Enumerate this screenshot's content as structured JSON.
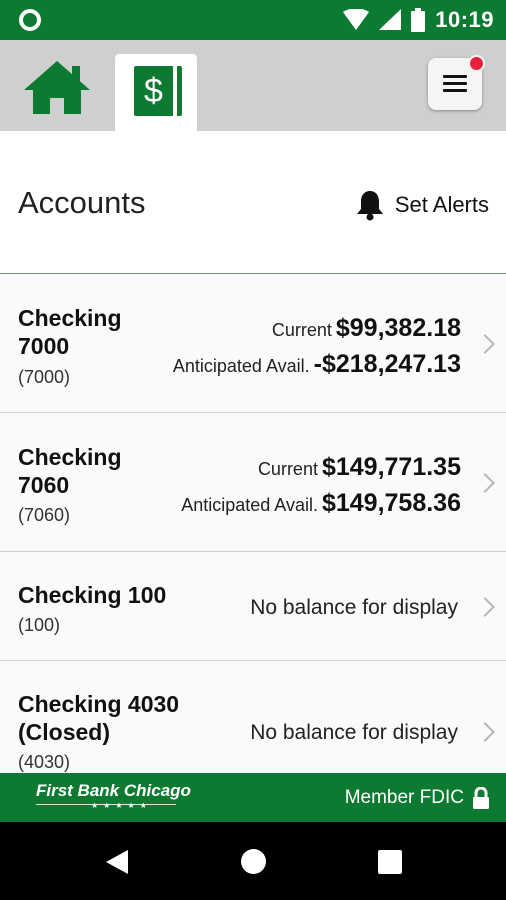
{
  "status_bar": {
    "time": "10:19"
  },
  "page": {
    "title": "Accounts",
    "alerts_label": "Set Alerts"
  },
  "accounts": [
    {
      "name_line1": "Checking",
      "name_line2": "7000",
      "number": "(7000)",
      "current_label": "Current",
      "current_value": "$99,382.18",
      "anticipated_label": "Anticipated Avail.",
      "anticipated_value": "-$218,247.13"
    },
    {
      "name_line1": "Checking",
      "name_line2": "7060",
      "number": "(7060)",
      "current_label": "Current",
      "current_value": "$149,771.35",
      "anticipated_label": "Anticipated Avail.",
      "anticipated_value": "$149,758.36"
    },
    {
      "name_line1": "Checking 100",
      "number": "(100)",
      "no_balance": "No balance for display"
    },
    {
      "name_line1": "Checking 4030",
      "name_line2": "(Closed)",
      "number": "(4030)",
      "no_balance": "No balance for display"
    }
  ],
  "footer": {
    "brand": "First Bank Chicago",
    "fdic": "Member FDIC"
  },
  "colors": {
    "brand_green": "#0d7a32",
    "notification": "#e8203a"
  }
}
